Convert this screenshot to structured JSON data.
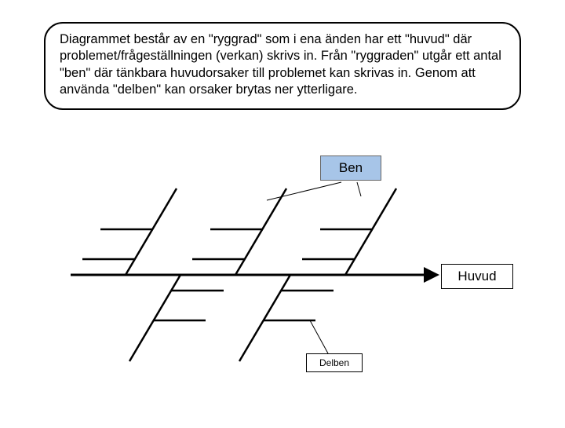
{
  "description": "Diagrammet består av en \"ryggrad\" som i ena änden har ett \"huvud\" där problemet/frågeställningen (verkan) skrivs in. Från \"ryggraden\" utgår ett antal \"ben\" där tänkbara huvudorsaker till problemet kan skrivas in. Genom att använda \"delben\" kan orsaker brytas ner ytterligare.",
  "labels": {
    "ben": "Ben",
    "huvud": "Huvud",
    "delben": "Delben"
  }
}
